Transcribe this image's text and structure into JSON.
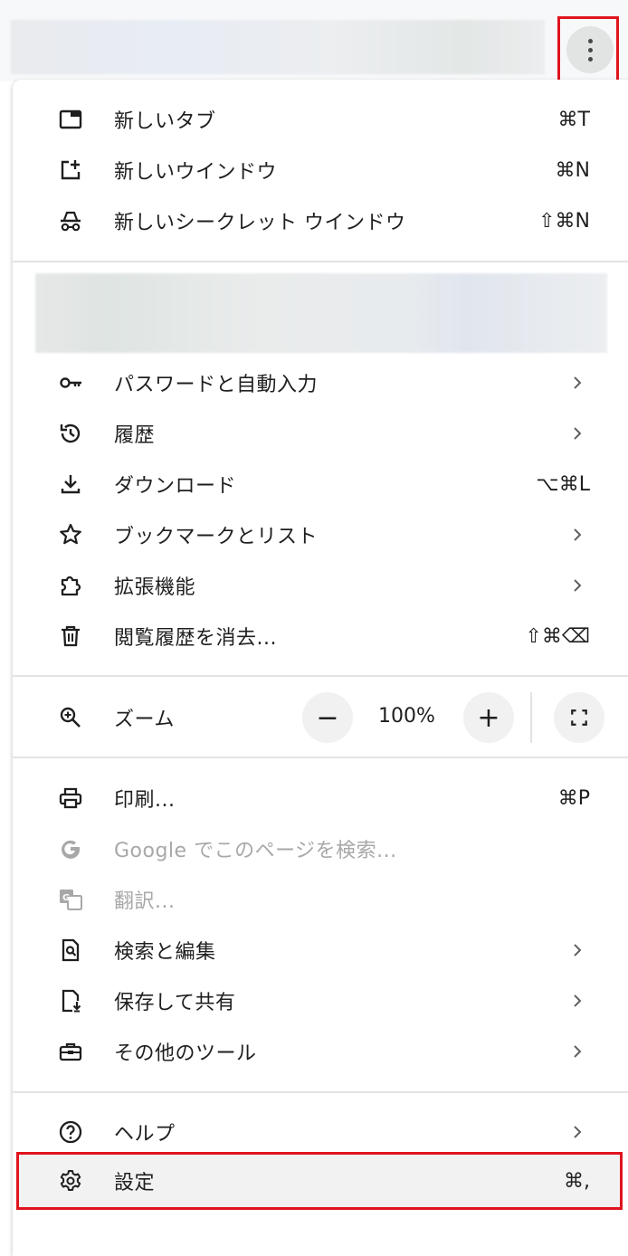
{
  "menu": {
    "new_section": [
      {
        "label": "新しいタブ",
        "shortcut": "⌘T",
        "icon": "new-tab-icon"
      },
      {
        "label": "新しいウインドウ",
        "shortcut": "⌘N",
        "icon": "new-window-icon"
      },
      {
        "label": "新しいシークレット ウインドウ",
        "shortcut": "⇧⌘N",
        "icon": "incognito-icon"
      }
    ],
    "account_section": [
      {
        "label": "パスワードと自動入力",
        "icon": "key-icon"
      },
      {
        "label": "履歴",
        "icon": "history-icon"
      },
      {
        "label": "ダウンロード",
        "shortcut": "⌥⌘L",
        "icon": "download-icon"
      },
      {
        "label": "ブックマークとリスト",
        "icon": "star-icon"
      },
      {
        "label": "拡張機能",
        "icon": "extension-icon"
      },
      {
        "label": "閲覧履歴を消去...",
        "shortcut": "⇧⌘⌫",
        "icon": "trash-icon"
      }
    ],
    "zoom": {
      "label": "ズーム",
      "value": "100%",
      "minus": "−",
      "plus": "+"
    },
    "tools_section": [
      {
        "label": "印刷...",
        "shortcut": "⌘P",
        "icon": "print-icon"
      },
      {
        "label": "Google でこのページを検索...",
        "icon": "google-icon",
        "disabled": true
      },
      {
        "label": "翻訳...",
        "icon": "translate-icon",
        "disabled": true
      },
      {
        "label": "検索と編集",
        "icon": "find-edit-icon"
      },
      {
        "label": "保存して共有",
        "icon": "save-share-icon"
      },
      {
        "label": "その他のツール",
        "icon": "toolbox-icon"
      }
    ],
    "help_section": [
      {
        "label": "ヘルプ",
        "icon": "help-icon"
      },
      {
        "label": "設定",
        "shortcut": "⌘,",
        "icon": "gear-icon"
      }
    ]
  },
  "colors": {
    "highlight_border": "#e0141e",
    "text": "#1f1f1f",
    "disabled": "#a8a8a8"
  }
}
